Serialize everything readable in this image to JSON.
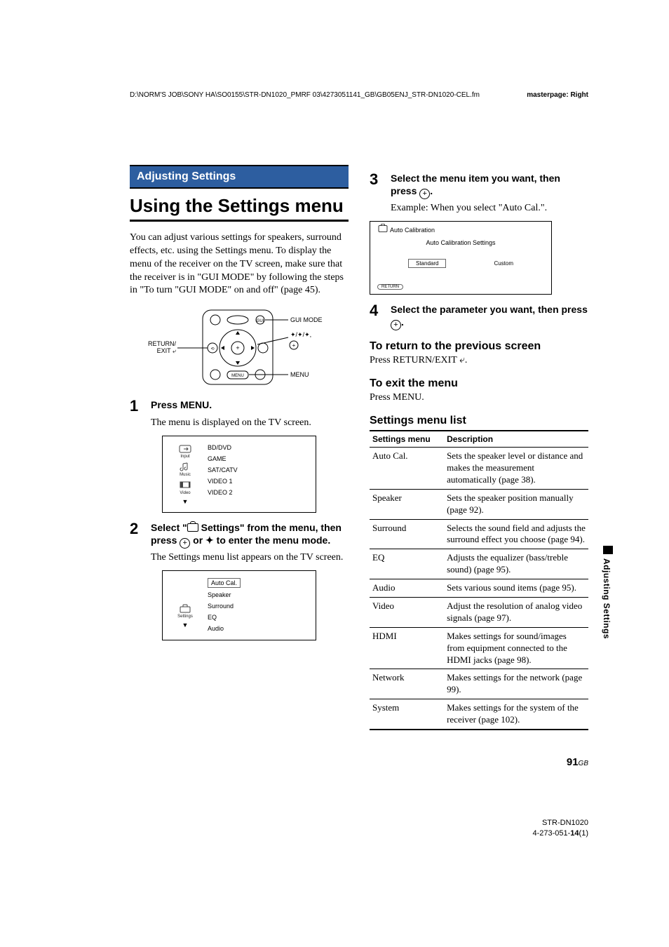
{
  "header": {
    "path": "D:\\NORM'S JOB\\SONY HA\\SO0155\\STR-DN1020_PMRF 03\\4273051141_GB\\GB05ENJ_STR-DN1020-CEL.fm",
    "masterpage": "masterpage: Right"
  },
  "section_bar": "Adjusting Settings",
  "h1": "Using the Settings menu",
  "intro": "You can adjust various settings for speakers, surround effects, etc. using the Settings menu. To display the menu of the receiver on the TV screen, make sure that the receiver is in \"GUI MODE\" by following the steps in \"To turn \"GUI MODE\" on and off\" (page 45).",
  "remote": {
    "left_label": "RETURN/\nEXIT ",
    "right_labels": {
      "gui": "GUI MODE",
      "dirs": "◆/◆/◆,",
      "menu": "MENU"
    },
    "menu_key": "MENU"
  },
  "step1": {
    "num": "1",
    "title": "Press MENU.",
    "body": "The menu is displayed on the TV screen."
  },
  "screen1": {
    "left": [
      {
        "icon": "Input"
      },
      {
        "icon": "Music"
      },
      {
        "icon": "Video"
      }
    ],
    "right": [
      "BD/DVD",
      "GAME",
      "SAT/CATV",
      "VIDEO 1",
      "VIDEO 2"
    ]
  },
  "step2": {
    "num": "2",
    "title_pre": "Select \"",
    "title_mid": " Settings\" from the menu, then press ",
    "title_post_a": " or ",
    "title_post_b": " to enter the menu mode.",
    "body": "The Settings menu list appears on the TV screen."
  },
  "screen2": {
    "left_label": "Settings",
    "right": [
      "Auto Cal.",
      "Speaker",
      "Surround",
      "EQ",
      "Audio"
    ]
  },
  "step3": {
    "num": "3",
    "title_a": "Select the menu item you want, then press ",
    "title_b": ".",
    "body": "Example: When you select \"Auto Cal.\"."
  },
  "screen3": {
    "title": "Auto Calibration",
    "subtitle": "Auto Calibration Settings",
    "buttons": [
      "Standard",
      "Custom"
    ],
    "return": "RETURN"
  },
  "step4": {
    "num": "4",
    "title_a": "Select the parameter you want, then press ",
    "title_b": "."
  },
  "h2_return": "To return to the previous screen",
  "body_return": "Press RETURN/EXIT ",
  "body_return_end": ".",
  "h2_exit": "To exit the menu",
  "body_exit": "Press MENU.",
  "h2_list": "Settings menu list",
  "table": {
    "headers": [
      "Settings menu",
      "Description"
    ],
    "rows": [
      [
        "Auto Cal.",
        "Sets the speaker level or distance and makes the measurement automatically (page 38)."
      ],
      [
        "Speaker",
        "Sets the speaker position manually (page 92)."
      ],
      [
        "Surround",
        "Selects the sound field and adjusts the surround effect you choose (page 94)."
      ],
      [
        "EQ",
        "Adjusts the equalizer (bass/treble sound) (page 95)."
      ],
      [
        "Audio",
        "Sets various sound items (page 95)."
      ],
      [
        "Video",
        "Adjust the resolution of analog video signals (page 97)."
      ],
      [
        "HDMI",
        "Makes settings for sound/images from equipment connected to the HDMI jacks (page 98)."
      ],
      [
        "Network",
        "Makes settings for the network (page 99)."
      ],
      [
        "System",
        "Makes settings for the system of the receiver (page 102)."
      ]
    ]
  },
  "side_tab": "Adjusting Settings",
  "page_num": {
    "num": "91",
    "region": "GB"
  },
  "footer": {
    "model": "STR-DN1020",
    "ref_a": "4-273-051-",
    "ref_b": "14",
    "ref_c": "(1)"
  }
}
